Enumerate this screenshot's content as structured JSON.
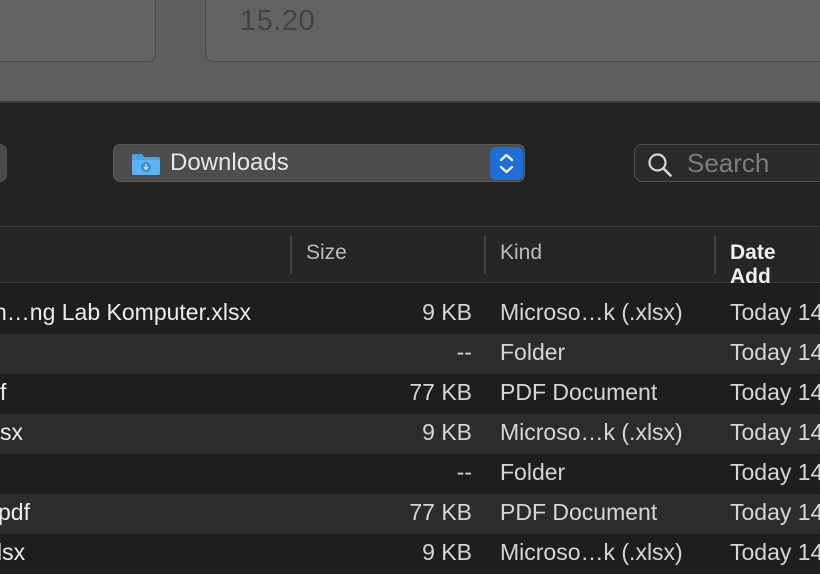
{
  "top": {
    "field_value": "15.20"
  },
  "toolbar": {
    "location": "Downloads",
    "search_placeholder": "Search",
    "folder_icon": "downloads-folder-icon",
    "accent": "#1f6fd6"
  },
  "columns": {
    "size": "Size",
    "kind": "Kind",
    "date": "Date Add"
  },
  "files": [
    {
      "name": "n…ng Lab Komputer.xlsx",
      "size": "9 KB",
      "kind": "Microso…k (.xlsx)",
      "date": "Today 14"
    },
    {
      "name": "",
      "size": "--",
      "kind": "Folder",
      "date": "Today 14"
    },
    {
      "name": "f",
      "size": "77 KB",
      "kind": "PDF Document",
      "date": "Today 14"
    },
    {
      "name": "sx",
      "size": "9 KB",
      "kind": "Microso…k (.xlsx)",
      "date": "Today 14"
    },
    {
      "name": "",
      "size": "--",
      "kind": "Folder",
      "date": "Today 14"
    },
    {
      "name": "pdf",
      "size": "77 KB",
      "kind": "PDF Document",
      "date": "Today 14"
    },
    {
      "name": "lsx",
      "size": "9 KB",
      "kind": "Microso…k (.xlsx)",
      "date": "Today 14"
    }
  ]
}
